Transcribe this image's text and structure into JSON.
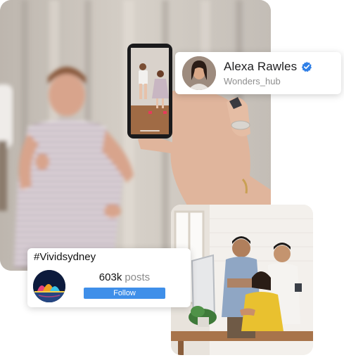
{
  "profile": {
    "name": "Alexa Rawles",
    "handle": "Wonders_hub",
    "verified": true
  },
  "hashtag": {
    "title": "#Vividsydney",
    "posts_count": "603k",
    "posts_label": "posts",
    "follow_label": "Follow"
  },
  "colors": {
    "accent": "#3f8fe9",
    "verified": "#2f7fe6"
  },
  "icons": {
    "verified": "verified-check-icon"
  }
}
